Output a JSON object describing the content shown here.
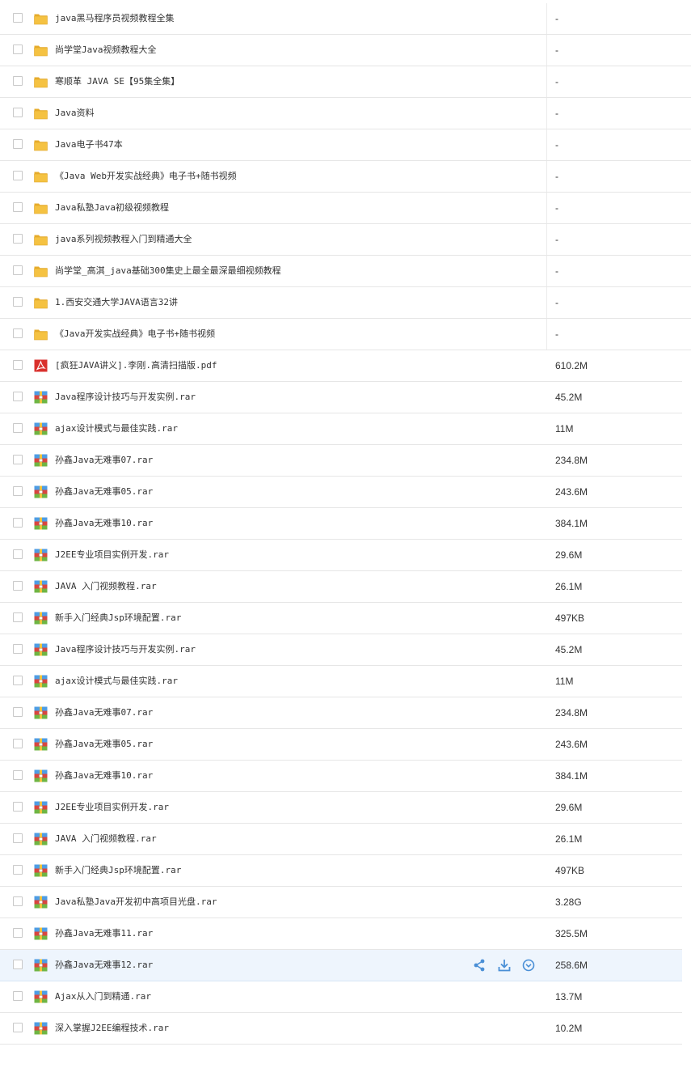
{
  "rows": [
    {
      "name": "java黑马程序员视频教程全集",
      "size": "-",
      "type": "folder"
    },
    {
      "name": "尚学堂Java视频教程大全",
      "size": "-",
      "type": "folder"
    },
    {
      "name": "寒顺革 JAVA SE【95集全集】",
      "size": "-",
      "type": "folder"
    },
    {
      "name": "Java资料",
      "size": "-",
      "type": "folder"
    },
    {
      "name": "Java电子书47本",
      "size": "-",
      "type": "folder"
    },
    {
      "name": "《Java Web开发实战经典》电子书+随书视频",
      "size": "-",
      "type": "folder"
    },
    {
      "name": "Java私塾Java初级视频教程",
      "size": "-",
      "type": "folder"
    },
    {
      "name": "java系列视频教程入门到精通大全",
      "size": "-",
      "type": "folder"
    },
    {
      "name": "尚学堂_高淇_java基础300集史上最全最深最细视频教程",
      "size": "-",
      "type": "folder"
    },
    {
      "name": "1.西安交通大学JAVA语言32讲",
      "size": "-",
      "type": "folder"
    },
    {
      "name": "《Java开发实战经典》电子书+随书视频",
      "size": "-",
      "type": "folder"
    },
    {
      "name": "[疯狂JAVA讲义].李刚.高清扫描版.pdf",
      "size": "610.2M",
      "type": "pdf"
    },
    {
      "name": "Java程序设计技巧与开发实例.rar",
      "size": "45.2M",
      "type": "rar"
    },
    {
      "name": "ajax设计模式与最佳实践.rar",
      "size": "11M",
      "type": "rar"
    },
    {
      "name": "孙鑫Java无难事07.rar",
      "size": "234.8M",
      "type": "rar"
    },
    {
      "name": "孙鑫Java无难事05.rar",
      "size": "243.6M",
      "type": "rar"
    },
    {
      "name": "孙鑫Java无难事10.rar",
      "size": "384.1M",
      "type": "rar"
    },
    {
      "name": "J2EE专业项目实例开发.rar",
      "size": "29.6M",
      "type": "rar"
    },
    {
      "name": "JAVA 入门视频教程.rar",
      "size": "26.1M",
      "type": "rar"
    },
    {
      "name": "新手入门经典Jsp环境配置.rar",
      "size": "497KB",
      "type": "rar"
    },
    {
      "name": "Java程序设计技巧与开发实例.rar",
      "size": "45.2M",
      "type": "rar"
    },
    {
      "name": "ajax设计模式与最佳实践.rar",
      "size": "11M",
      "type": "rar"
    },
    {
      "name": "孙鑫Java无难事07.rar",
      "size": "234.8M",
      "type": "rar"
    },
    {
      "name": "孙鑫Java无难事05.rar",
      "size": "243.6M",
      "type": "rar"
    },
    {
      "name": "孙鑫Java无难事10.rar",
      "size": "384.1M",
      "type": "rar"
    },
    {
      "name": "J2EE专业项目实例开发.rar",
      "size": "29.6M",
      "type": "rar"
    },
    {
      "name": "JAVA 入门视频教程.rar",
      "size": "26.1M",
      "type": "rar"
    },
    {
      "name": "新手入门经典Jsp环境配置.rar",
      "size": "497KB",
      "type": "rar"
    },
    {
      "name": "Java私塾Java开发初中高项目光盘.rar",
      "size": "3.28G",
      "type": "rar"
    },
    {
      "name": "孙鑫Java无难事11.rar",
      "size": "325.5M",
      "type": "rar"
    },
    {
      "name": "孙鑫Java无难事12.rar",
      "size": "258.6M",
      "type": "rar",
      "hovered": true
    },
    {
      "name": "Ajax从入门到精通.rar",
      "size": "13.7M",
      "type": "rar"
    },
    {
      "name": "深入掌握J2EE编程技术.rar",
      "size": "10.2M",
      "type": "rar"
    }
  ],
  "hover_actions": [
    "share-icon",
    "download-icon",
    "more-icon"
  ],
  "colors": {
    "folder": "#f5c242",
    "pdf": "#d9302c",
    "action": "#4a8fd6",
    "hover_bg": "#eef5fd"
  }
}
